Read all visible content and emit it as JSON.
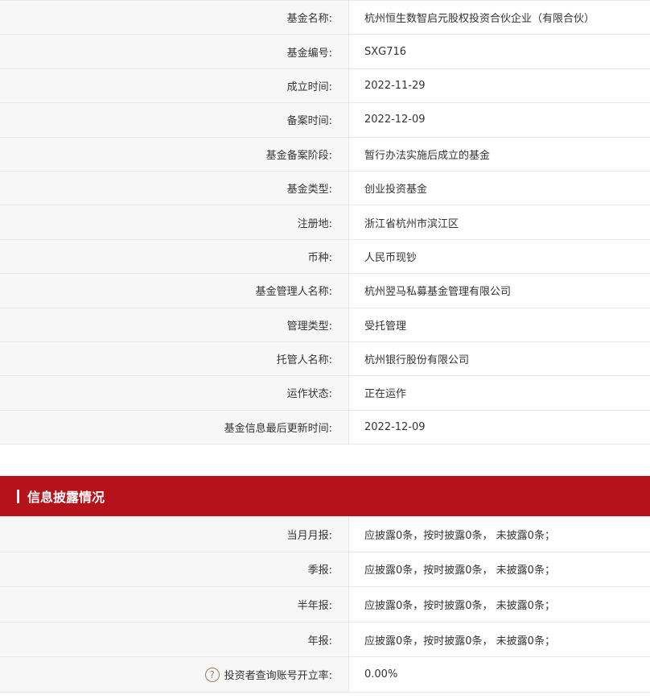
{
  "fund_info": [
    {
      "label": "基金名称:",
      "value": "杭州恒生数智启元股权投资合伙企业（有限合伙）"
    },
    {
      "label": "基金编号:",
      "value": "SXG716"
    },
    {
      "label": "成立时间:",
      "value": "2022-11-29"
    },
    {
      "label": "备案时间:",
      "value": "2022-12-09"
    },
    {
      "label": "基金备案阶段:",
      "value": "暂行办法实施后成立的基金"
    },
    {
      "label": "基金类型:",
      "value": "创业投资基金"
    },
    {
      "label": "注册地:",
      "value": "浙江省杭州市滨江区"
    },
    {
      "label": "币种:",
      "value": "人民币现钞"
    },
    {
      "label": "基金管理人名称:",
      "value": "杭州翌马私募基金管理有限公司"
    },
    {
      "label": "管理类型:",
      "value": "受托管理"
    },
    {
      "label": "托管人名称:",
      "value": "杭州银行股份有限公司"
    },
    {
      "label": "运作状态:",
      "value": "正在运作"
    },
    {
      "label": "基金信息最后更新时间:",
      "value": "2022-12-09"
    }
  ],
  "disclosure": {
    "title": "信息披露情况",
    "rows": [
      {
        "label": "当月月报:",
        "value": "应披露0条，按时披露0条， 未披露0条；"
      },
      {
        "label": "季报:",
        "value": "应披露0条，按时披露0条， 未披露0条；"
      },
      {
        "label": "半年报:",
        "value": "应披露0条，按时披露0条， 未披露0条；"
      },
      {
        "label": "年报:",
        "value": "应披露0条，按时披露0条， 未披露0条；"
      }
    ],
    "investor_rate": {
      "icon_glyph": "?",
      "label": "投资者查询账号开立率:",
      "value": "0.00%"
    }
  },
  "colors": {
    "accent_red": "#b5121b",
    "label_bg": "#f7f7f7",
    "border": "#e8e8e8",
    "help_icon": "#a07d5b"
  }
}
